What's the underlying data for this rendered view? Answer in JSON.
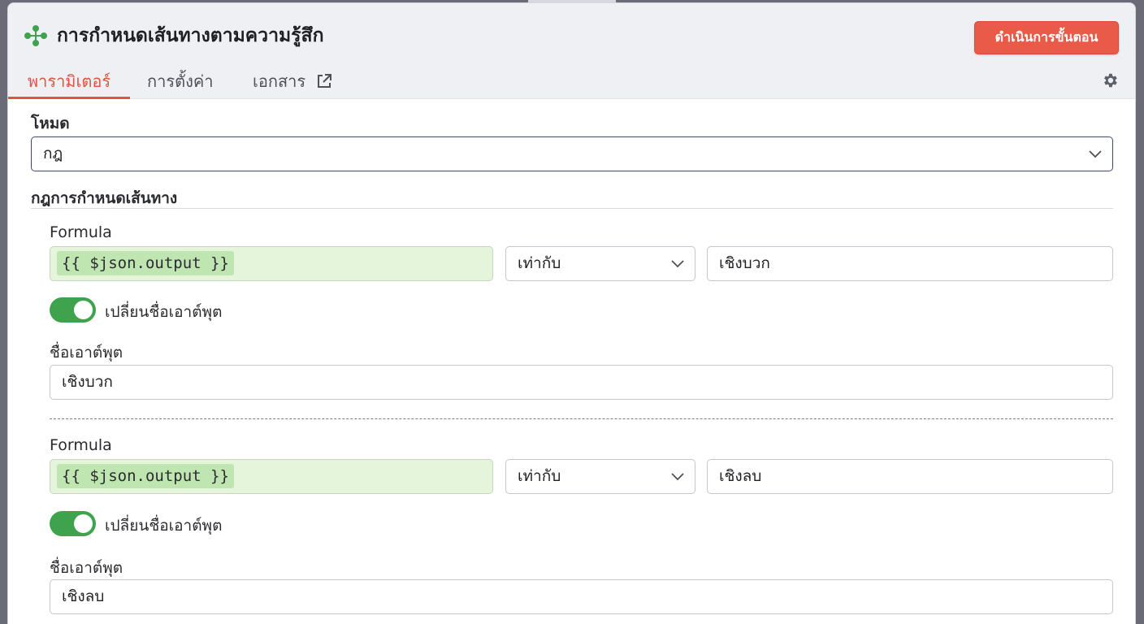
{
  "node": {
    "title": "การกำหนดเส้นทางตามความรู้สึก",
    "icon": "switch-node-icon",
    "execute_label": "ดำเนินการขั้นตอน",
    "accent_color": "#ea5a48"
  },
  "tabs": [
    {
      "label": "พารามิเตอร์",
      "active": true
    },
    {
      "label": "การตั้งค่า",
      "active": false
    },
    {
      "label": "เอกสาร",
      "active": false,
      "icon": "external-link-icon"
    }
  ],
  "settings_icon": "gear-icon",
  "mode": {
    "label": "โหมด",
    "value": "กฎ"
  },
  "routing_rules": {
    "label": "กฎการกำหนดเส้นทาง",
    "rules": [
      {
        "formula_label": "Formula",
        "formula_value": "{{ $json.output }}",
        "operator": "เท่ากับ",
        "compare_value": "เชิงบวก",
        "rename_toggle_label": "เปลี่ยนชื่อเอาต์พุต",
        "rename_toggle_on": true,
        "output_name_label": "ชื่อเอาต์พุต",
        "output_name_value": "เชิงบวก"
      },
      {
        "formula_label": "Formula",
        "formula_value": "{{ $json.output }}",
        "operator": "เท่ากับ",
        "compare_value": "เชิงลบ",
        "rename_toggle_label": "เปลี่ยนชื่อเอาต์พุต",
        "rename_toggle_on": true,
        "output_name_label": "ชื่อเอาต์พุต",
        "output_name_value": "เชิงลบ"
      }
    ]
  }
}
